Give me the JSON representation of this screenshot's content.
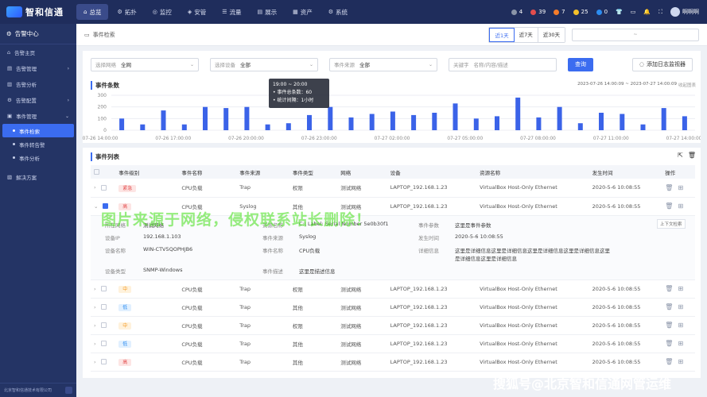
{
  "brand": {
    "name": "智和信通"
  },
  "nav": [
    {
      "label": "总览",
      "icon": "home-icon",
      "active": true
    },
    {
      "label": "拓扑",
      "icon": "topology-icon"
    },
    {
      "label": "监控",
      "icon": "monitor-icon"
    },
    {
      "label": "安管",
      "icon": "shield-icon"
    },
    {
      "label": "流量",
      "icon": "traffic-icon"
    },
    {
      "label": "展示",
      "icon": "display-icon"
    },
    {
      "label": "资产",
      "icon": "asset-icon"
    },
    {
      "label": "系统",
      "icon": "system-icon"
    }
  ],
  "alarms": [
    {
      "count": "4",
      "color": "#8a94a8"
    },
    {
      "count": "39",
      "color": "#e34d4d"
    },
    {
      "count": "7",
      "color": "#f57c2a"
    },
    {
      "count": "25",
      "color": "#f5c02a"
    },
    {
      "count": "0",
      "color": "#2c8cf0"
    }
  ],
  "user": {
    "name": "啊啊啊"
  },
  "sidebar": {
    "title": "告警中心",
    "items": [
      {
        "label": "告警主页"
      },
      {
        "label": "告警管理"
      },
      {
        "label": "告警分析"
      },
      {
        "label": "告警配置"
      },
      {
        "label": "事件管理"
      }
    ],
    "subitems": [
      {
        "label": "事件检索",
        "active": true
      },
      {
        "label": "事件转告警"
      },
      {
        "label": "事件分析"
      }
    ],
    "extra": {
      "label": "解决方案"
    },
    "footer": "北京智和信通技术有限公司"
  },
  "header": {
    "title": "事件检索",
    "ranges": [
      "近1天",
      "近7天",
      "近30天"
    ],
    "date_sep": "~"
  },
  "filters": {
    "network": {
      "label": "选择网络",
      "value": "全网"
    },
    "device": {
      "label": "选择设备",
      "value": "全部"
    },
    "source": {
      "label": "事件来源",
      "value": "全部"
    },
    "keyword": {
      "label": "关键字",
      "placeholder": "名称/内容/描述"
    },
    "query_btn": "查询",
    "add_btn": "添加日志监视器"
  },
  "chart_panel": {
    "title": "事件条数",
    "range": "2023-07-26 14:00:09 ~ 2023-07-27 14:00:09",
    "collapse": "收起图表"
  },
  "chart_data": {
    "type": "bar",
    "x_ticks": [
      "07-26 14:00:00",
      "07-26 17:00:00",
      "07-26 20:00:00",
      "07-26 23:00:00",
      "07-27 02:00:00",
      "07-27 05:00:00",
      "07-27 08:00:00",
      "07-27 11:00:00",
      "07-27 14:00:00"
    ],
    "yticks": [
      300,
      200,
      100,
      0
    ],
    "ylim": [
      0,
      300
    ],
    "values": [
      100,
      50,
      170,
      50,
      200,
      190,
      200,
      50,
      60,
      130,
      200,
      110,
      140,
      160,
      130,
      150,
      230,
      100,
      120,
      280,
      110,
      200,
      60,
      150,
      140,
      50,
      190,
      120
    ],
    "color": "#3b63e8"
  },
  "tooltip": {
    "time": "19:00 ~ 20:00",
    "count_label": "事件总条数：",
    "count": "60",
    "interval_label": "统计间隔：",
    "interval": "1小时"
  },
  "list_panel": {
    "title": "事件列表"
  },
  "table": {
    "headers": [
      "事件级别",
      "事件名称",
      "事件来源",
      "事件类型",
      "网络",
      "设备",
      "资源名称",
      "发生时间",
      "操作"
    ],
    "rows": [
      {
        "level": "紧急",
        "level_class": "lvl-high",
        "name": "CPU负载",
        "source": "Trap",
        "type": "权限",
        "network": "测试网络",
        "device": "LAPTOP_192.168.1.23",
        "resource": "VirtualBox Host-Only Ethernet",
        "time": "2020-5-6 10:08:55"
      },
      {
        "level": "高",
        "level_class": "lvl-high",
        "name": "CPU负载",
        "source": "Syslog",
        "type": "其他",
        "network": "测试网络",
        "device": "LAPTOP_192.168.1.23",
        "resource": "VirtualBox Host-Only Ethernet",
        "time": "2020-5-6 10:08:55"
      },
      {
        "level": "中",
        "level_class": "lvl-mid",
        "name": "CPU负载",
        "source": "Trap",
        "type": "权限",
        "network": "测试网络",
        "device": "LAPTOP_192.168.1.23",
        "resource": "VirtualBox Host-Only Ethernet",
        "time": "2020-5-6 10:08:55"
      },
      {
        "level": "低",
        "level_class": "lvl-low",
        "name": "CPU负载",
        "source": "Trap",
        "type": "其他",
        "network": "测试网络",
        "device": "LAPTOP_192.168.1.23",
        "resource": "VirtualBox Host-Only Ethernet",
        "time": "2020-5-6 10:08:55"
      },
      {
        "level": "中",
        "level_class": "lvl-mid",
        "name": "CPU负载",
        "source": "Trap",
        "type": "权限",
        "network": "测试网络",
        "device": "LAPTOP_192.168.1.23",
        "resource": "VirtualBox Host-Only Ethernet",
        "time": "2020-5-6 10:08:55"
      },
      {
        "level": "低",
        "level_class": "lvl-low",
        "name": "CPU负载",
        "source": "Trap",
        "type": "其他",
        "network": "测试网络",
        "device": "LAPTOP_192.168.1.23",
        "resource": "VirtualBox Host-Only Ethernet",
        "time": "2020-5-6 10:08:55"
      },
      {
        "level": "高",
        "level_class": "lvl-high",
        "name": "CPU负载",
        "source": "Trap",
        "type": "其他",
        "network": "测试网络",
        "device": "LAPTOP_192.168.1.23",
        "resource": "VirtualBox Host-Only Ethernet",
        "time": "2020-5-6 10:08:55"
      }
    ],
    "detail": {
      "network_k": "所在网络",
      "network_v": "测试网络",
      "res_k": "资源名称",
      "res_v": "C:\\ Label:  Serial Number 5e0b30f1",
      "param_k": "事件参数",
      "param_v": "这里是事件参数",
      "ip_k": "设备IP",
      "ip_v": "192.168.1.103",
      "src_k": "事件来源",
      "src_v": "Syslog",
      "time_k": "发生时间",
      "time_v": "2020-5-6 10:08:55",
      "devname_k": "设备名称",
      "devname_v": "WIN-CTV5QOPHJB6",
      "evname_k": "事件名称",
      "evname_v": "CPU负载",
      "info_k": "详细信息",
      "info_v": "这里是详细信息这里是详细信息这里是详细信息这里是详细信息这里是详细信息这里是详细信息",
      "devtype_k": "设备类型",
      "devtype_v": "SNMP-Windows",
      "desc_k": "事件描述",
      "desc_v": "这里是描述信息"
    },
    "context_tip": "上下文检索"
  },
  "watermarks": {
    "center": "图片来源于网络，侵权联系站长删除！",
    "corner": "搜狐号@北京智和信通网管运维"
  }
}
